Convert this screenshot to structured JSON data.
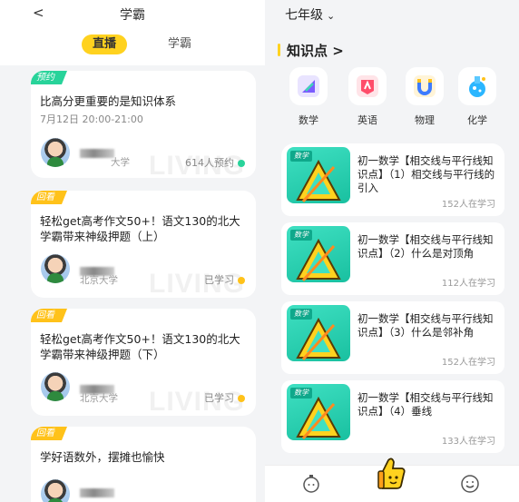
{
  "left": {
    "back_icon": "chevron-left-icon",
    "back_glyph": "<",
    "title": "学霸",
    "segments": [
      {
        "label": "直播",
        "active": true
      },
      {
        "label": "学霸",
        "active": false
      }
    ],
    "cards": [
      {
        "badge": "预约",
        "title": "比高分更重要的是知识体系",
        "time": "7月12日 20:00-21:00",
        "school": "大学",
        "watermark": "LIVING",
        "meta": "614人预约",
        "dot_color": "#28d39a"
      },
      {
        "badge": "回看",
        "title": "轻松get高考作文50+！语文130的北大学霸带来神级押题（上）",
        "school": "北京大学",
        "watermark": "LIVING",
        "meta": "已学习",
        "dot_color": "#ffc21a"
      },
      {
        "badge": "回看",
        "title": "轻松get高考作文50+！语文130的北大学霸带来神级押题（下）",
        "school": "北京大学",
        "watermark": "LIVING",
        "meta": "已学习",
        "dot_color": "#ffc21a"
      },
      {
        "badge": "回看",
        "title": "学好语数外，摆摊也愉快"
      }
    ]
  },
  "right": {
    "grade": "七年级",
    "grade_icon": "chevron-down-icon",
    "knowledge_title": "知识点",
    "knowledge_arrow": ">",
    "subjects": [
      {
        "label": "数学",
        "icon": "math-icon",
        "color": "#7b5cff"
      },
      {
        "label": "英语",
        "icon": "english-icon",
        "color": "#ff4d6a"
      },
      {
        "label": "物理",
        "icon": "physics-magnet-icon",
        "color": "#3d7bff"
      },
      {
        "label": "化学",
        "icon": "chemistry-flask-icon",
        "color": "#2bb6ff"
      }
    ],
    "lessons": [
      {
        "tag": "数学",
        "title": "初一数学【相交线与平行线知识点】（1）相交线与平行线的引入",
        "count": "152人在学习"
      },
      {
        "tag": "数学",
        "title": "初一数学【相交线与平行线知识点】（2）什么是对顶角",
        "count": "112人在学习"
      },
      {
        "tag": "数学",
        "title": "初一数学【相交线与平行线知识点】（3）什么是邻补角",
        "count": "152人在学习"
      },
      {
        "tag": "数学",
        "title": "初一数学【相交线与平行线知识点】（4）垂线",
        "count": "133人在学习"
      }
    ],
    "tabbar": [
      "timer-face-icon",
      "thumbs-up-mascot-icon",
      "smile-face-icon"
    ]
  }
}
